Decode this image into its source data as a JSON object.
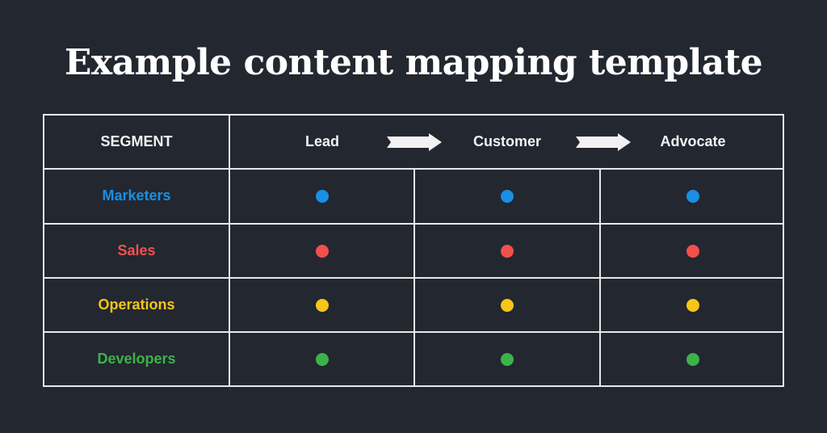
{
  "title": "Example content mapping template",
  "header": {
    "segment_label": "SEGMENT",
    "stages": [
      "Lead",
      "Customer",
      "Advocate"
    ],
    "arrow_icon": "right-arrow-icon"
  },
  "rows": [
    {
      "segment": "Marketers",
      "color": "#1a8fe3",
      "marks": [
        true,
        true,
        true
      ]
    },
    {
      "segment": "Sales",
      "color": "#f2504b",
      "marks": [
        true,
        true,
        true
      ]
    },
    {
      "segment": "Operations",
      "color": "#f5c518",
      "marks": [
        true,
        true,
        true
      ]
    },
    {
      "segment": "Developers",
      "color": "#3db24a",
      "marks": [
        true,
        true,
        true
      ]
    }
  ],
  "colors": {
    "background": "#232730",
    "grid_lines": "#e8e8e8",
    "text": "#ffffff"
  }
}
